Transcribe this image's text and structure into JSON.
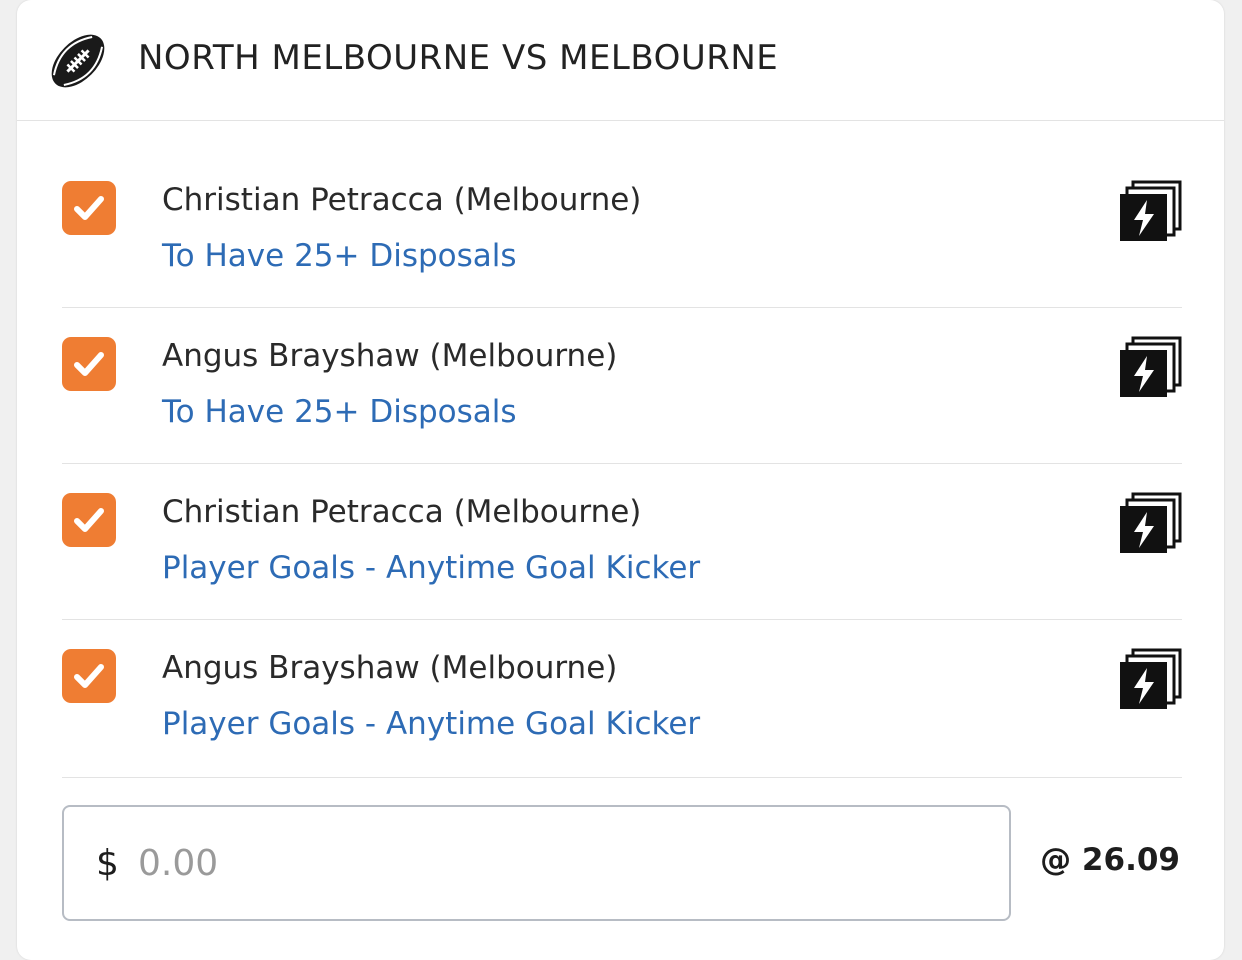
{
  "header": {
    "title": "NORTH MELBOURNE VS MELBOURNE",
    "icon": "football-icon"
  },
  "legs": [
    {
      "player": "Christian Petracca (Melbourne)",
      "market": "To Have 25+ Disposals",
      "checked": true
    },
    {
      "player": "Angus Brayshaw (Melbourne)",
      "market": "To Have 25+ Disposals",
      "checked": true
    },
    {
      "player": "Christian Petracca (Melbourne)",
      "market": "Player Goals - Anytime Goal Kicker",
      "checked": true
    },
    {
      "player": "Angus Brayshaw (Melbourne)",
      "market": "Player Goals - Anytime Goal Kicker",
      "checked": true
    }
  ],
  "stake": {
    "currency": "$",
    "placeholder": "0.00",
    "value": ""
  },
  "odds": "@ 26.09",
  "colors": {
    "checkbox": "#ef7d33",
    "market_link": "#2d6bb5",
    "text": "#222222"
  }
}
